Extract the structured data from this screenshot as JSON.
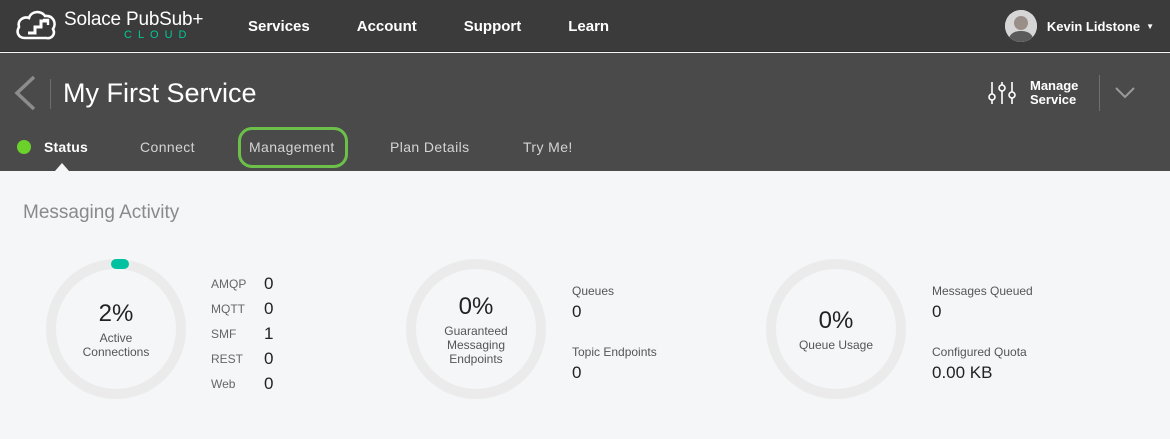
{
  "brand": {
    "name": "Solace PubSub+",
    "sub": "CLOUD",
    "accent": "#00c895"
  },
  "nav": {
    "items": [
      "Services",
      "Account",
      "Support",
      "Learn"
    ]
  },
  "user": {
    "name": "Kevin Lidstone",
    "avatar_icon": "user-avatar"
  },
  "service": {
    "title": "My First Service",
    "manage_label_line1": "Manage",
    "manage_label_line2": "Service",
    "status_color": "#6bd12b"
  },
  "tabs": {
    "items": [
      "Status",
      "Connect",
      "Management",
      "Plan Details",
      "Try Me!"
    ],
    "active": "Status",
    "highlighted": "Management",
    "highlight_color": "#6cc04a"
  },
  "activity": {
    "title": "Messaging Activity",
    "connections": {
      "value": "2%",
      "percent": 2,
      "label_line1": "Active",
      "label_line2": "Connections",
      "progress_color": "#00c2a0"
    },
    "protocols": [
      {
        "name": "AMQP",
        "value": "0"
      },
      {
        "name": "MQTT",
        "value": "0"
      },
      {
        "name": "SMF",
        "value": "1"
      },
      {
        "name": "REST",
        "value": "0"
      },
      {
        "name": "Web",
        "value": "0"
      }
    ],
    "endpoints": {
      "value": "0%",
      "label_line1": "Guaranteed",
      "label_line2": "Messaging",
      "label_line3": "Endpoints"
    },
    "endpoint_stats": {
      "queues_label": "Queues",
      "queues_value": "0",
      "topic_label": "Topic Endpoints",
      "topic_value": "0"
    },
    "queue_usage": {
      "value": "0%",
      "label": "Queue Usage"
    },
    "queue_stats": {
      "queued_label": "Messages Queued",
      "queued_value": "0",
      "quota_label": "Configured Quota",
      "quota_value": "0.00 KB"
    }
  }
}
